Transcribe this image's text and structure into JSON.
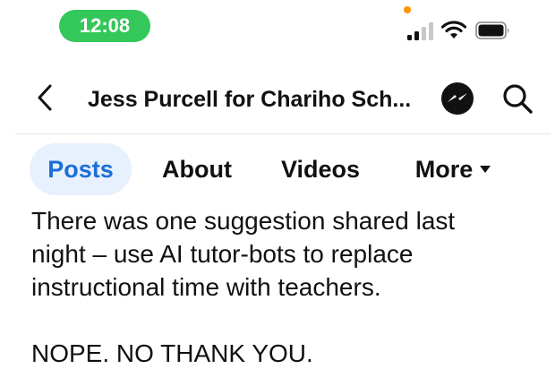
{
  "status_bar": {
    "time": "12:08",
    "time_pill_color": "#34c759",
    "indicator_dot_color": "#ff9500",
    "icons": [
      "cellular-signal-icon",
      "wifi-icon",
      "battery-icon"
    ]
  },
  "header": {
    "page_name": "Jess Purcell for Chariho Sch...",
    "icons": [
      "back-chevron-icon",
      "messenger-icon",
      "search-icon"
    ]
  },
  "tabs": [
    {
      "label": "Posts",
      "active": true
    },
    {
      "label": "About",
      "active": false
    },
    {
      "label": "Videos",
      "active": false
    },
    {
      "label": "More",
      "active": false
    }
  ],
  "colors": {
    "accent": "#1a6ed8",
    "active_tab_bg": "#e7f0fd"
  },
  "post": {
    "lines": [
      "There was one suggestion shared last",
      "night – use AI tutor-bots to replace",
      "instructional time with teachers."
    ],
    "closing": "NOPE. NO THANK YOU."
  }
}
